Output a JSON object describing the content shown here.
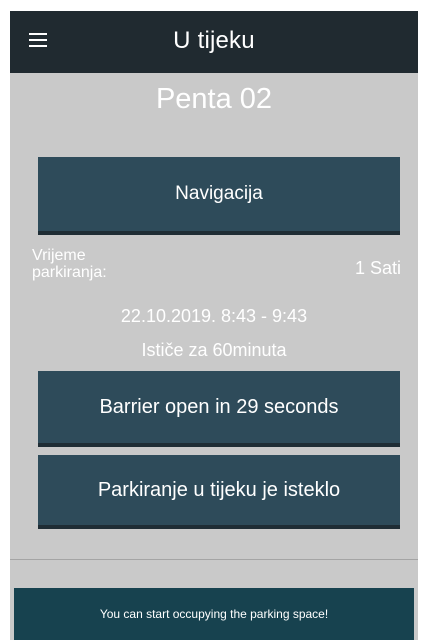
{
  "header": {
    "title": "U tijeku",
    "menu_icon": "hamburger-menu-icon"
  },
  "parking": {
    "name": "Penta 02"
  },
  "navigation_button": {
    "label": "Navigacija"
  },
  "duration": {
    "label": "Vrijeme parkiranja:",
    "value": "1 Sati"
  },
  "session": {
    "interval": "22.10.2019. 8:43 - 9:43",
    "expires_text": "Ističe za  60minuta"
  },
  "barrier_button": {
    "label": "Barrier open in 29 seconds"
  },
  "status_button": {
    "label": "Parkiranje u tijeku je isteklo"
  },
  "toast": {
    "message": "You can start occupying the parking space!"
  },
  "colors": {
    "appbar": "#202a30",
    "background": "#c9c9c9",
    "button": "#2e4b5a",
    "toast": "#17424f"
  }
}
